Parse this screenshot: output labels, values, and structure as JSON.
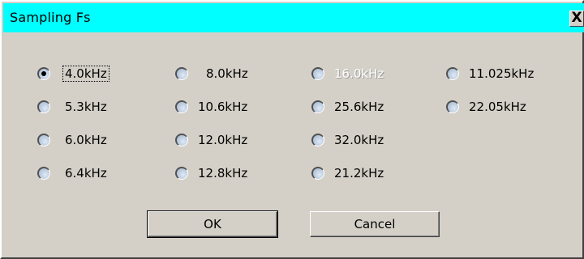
{
  "window": {
    "title": "Sampling Fs",
    "close_glyph": "X"
  },
  "options": [
    {
      "label": "4.0kHz",
      "checked": true,
      "disabled": false,
      "focused": true
    },
    {
      "label": "5.3kHz",
      "checked": false,
      "disabled": false
    },
    {
      "label": "6.0kHz",
      "checked": false,
      "disabled": false
    },
    {
      "label": "6.4kHz",
      "checked": false,
      "disabled": false
    },
    {
      "label": "8.0kHz",
      "checked": false,
      "disabled": false
    },
    {
      "label": "10.6kHz",
      "checked": false,
      "disabled": false
    },
    {
      "label": "12.0kHz",
      "checked": false,
      "disabled": false
    },
    {
      "label": "12.8kHz",
      "checked": false,
      "disabled": false
    },
    {
      "label": "16.0kHz",
      "checked": false,
      "disabled": true
    },
    {
      "label": "25.6kHz",
      "checked": false,
      "disabled": false
    },
    {
      "label": "32.0kHz",
      "checked": false,
      "disabled": false
    },
    {
      "label": "21.2kHz",
      "checked": false,
      "disabled": false
    },
    {
      "label": "11.025kHz",
      "checked": false,
      "disabled": false
    },
    {
      "label": "22.05kHz",
      "checked": false,
      "disabled": false
    }
  ],
  "buttons": {
    "ok_label": "OK",
    "cancel_label": "Cancel"
  },
  "colors": {
    "titlebar": "#00ffff",
    "dialog_face": "#d4d0c8"
  }
}
